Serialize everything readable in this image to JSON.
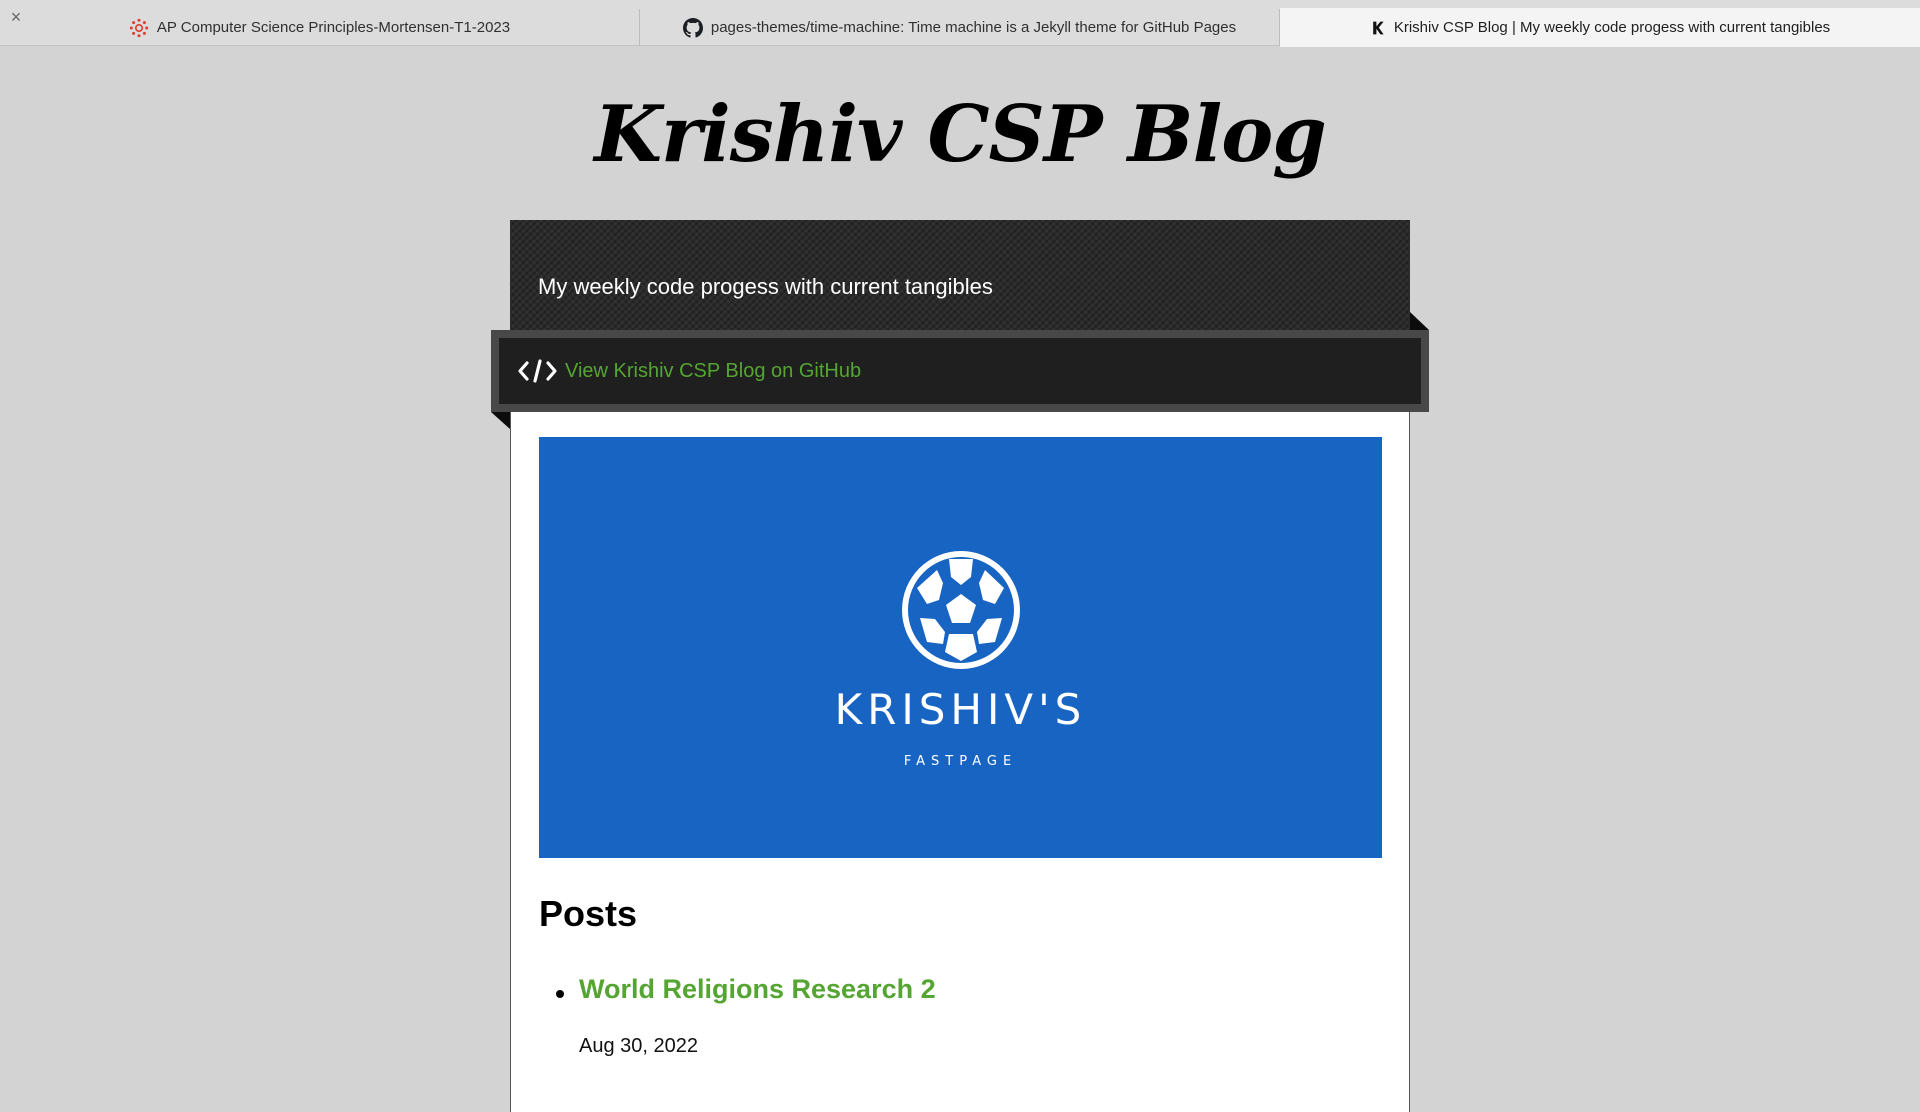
{
  "browser": {
    "tabs": [
      {
        "label": "AP Computer Science Principles-Mortensen-T1-2023",
        "icon": "canvas-logo-icon",
        "active": false
      },
      {
        "label": "pages-themes/time-machine: Time machine is a Jekyll theme for GitHub Pages",
        "icon": "github-icon",
        "active": false
      },
      {
        "label": "Krishiv CSP Blog | My weekly code progess with current tangibles",
        "icon": "k-favicon-icon",
        "active": true
      }
    ],
    "close_symbol": "×"
  },
  "site": {
    "title": "Krishiv CSP Blog",
    "tagline": "My weekly code progess with current tangibles",
    "github_link_label": "View Krishiv CSP Blog on GitHub"
  },
  "banner": {
    "title": "KRISHIV'S",
    "subtitle": "FASTPAGE",
    "background_color": "#1764c2",
    "icon": "soccer-ball-icon"
  },
  "posts": {
    "heading": "Posts",
    "items": [
      {
        "title": "World Religions Research 2",
        "date": "Aug 30, 2022"
      }
    ]
  },
  "colors": {
    "page_background": "#d3d3d3",
    "link_green": "#55a532",
    "header_dark": "#2b2b2b"
  }
}
